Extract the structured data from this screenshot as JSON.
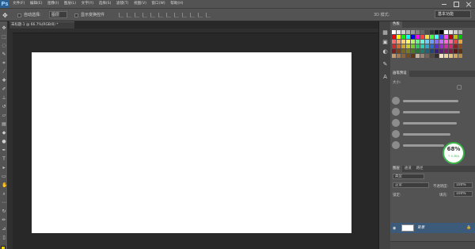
{
  "app": {
    "logo": "Ps"
  },
  "menu": [
    "文件(F)",
    "编辑(E)",
    "图像(I)",
    "图层(L)",
    "文字(Y)",
    "选择(S)",
    "滤镜(T)",
    "视图(V)",
    "窗口(W)",
    "帮助(H)"
  ],
  "options": {
    "auto_select_label": "自动选择:",
    "auto_select_value": "图层",
    "show_transform_label": "显示变换控件",
    "mode_3d_label": "3D 模式:",
    "workspace": "基本功能"
  },
  "document": {
    "tab_title": "未标题-1 @ 66.7%(RGB/8) *",
    "canvas_color": "#ffffff"
  },
  "panels": {
    "swatch_tabs": [
      "色板"
    ],
    "brush_tabs": [
      "画笔预设"
    ],
    "brush_size_label": "大小:",
    "layers_tabs": [
      "图层",
      "通道",
      "路径"
    ],
    "kind_label": "类型",
    "blend_mode": "正常",
    "opacity_label": "不透明度:",
    "opacity_value": "100%",
    "lock_label": "锁定:",
    "fill_label": "填充:",
    "fill_value": "100%",
    "layer_name": "背景"
  },
  "meter": {
    "percent": "68%",
    "speed": "↑ 0.3K/s"
  },
  "colors": {
    "foreground": "#f5d40a",
    "background": "#ffffff",
    "accent": "#39b54a"
  }
}
